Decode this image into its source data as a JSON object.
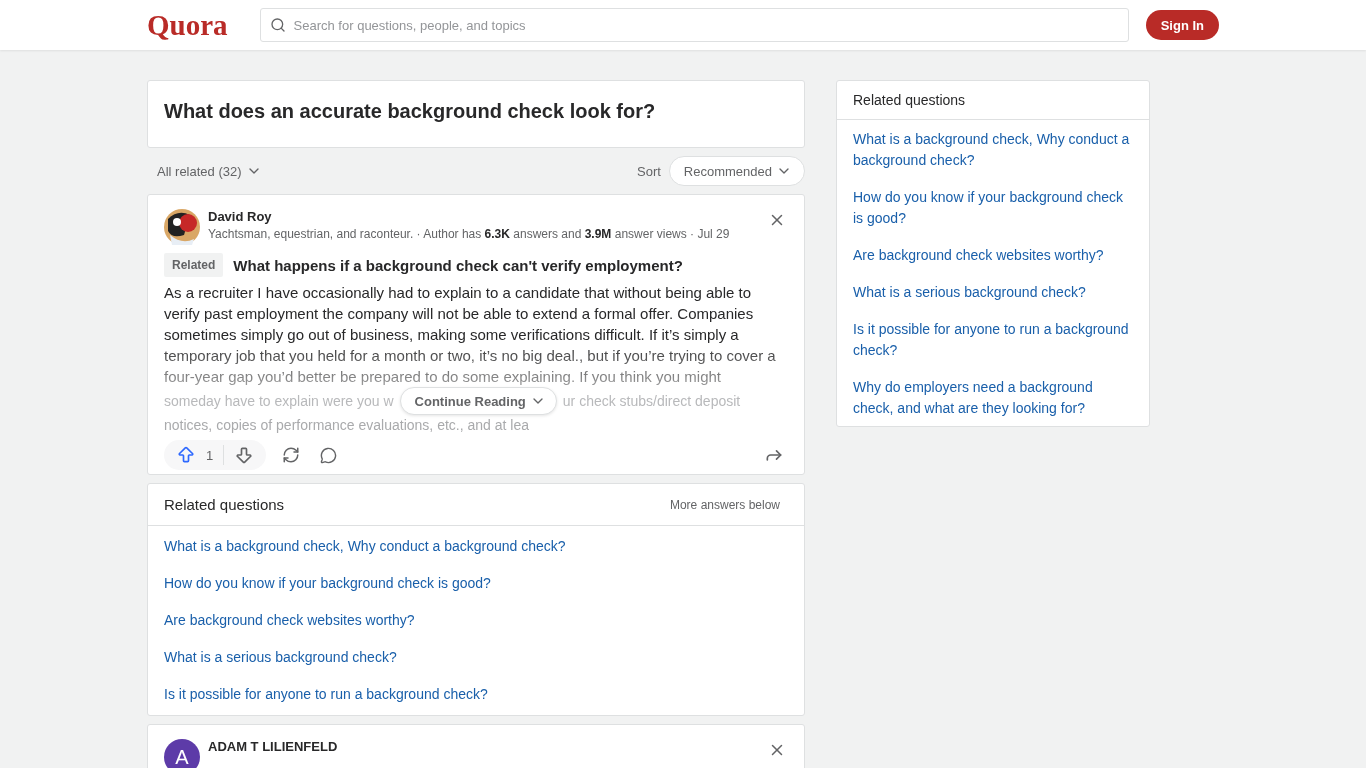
{
  "header": {
    "logo": "Quora",
    "search_placeholder": "Search for questions, people, and topics",
    "sign_in": "Sign In"
  },
  "question": {
    "title": "What does an accurate background check look for?"
  },
  "filter": {
    "all_related": "All related (32)",
    "sort_label": "Sort",
    "sort_value": "Recommended"
  },
  "answers": [
    {
      "author": "David Roy",
      "kind": "cartoon",
      "credential": "Yachtsman, equestrian, and raconteur. · Author has **6.3K** answers and **3.9M** answer views · Jul 29",
      "tag": "Related",
      "related_question": "What happens if a background check can't verify employment?",
      "body": "As a recruiter I have occasionally had to explain to a candidate that without being able to verify past employment the company will not be able to extend a formal offer. Companies sometimes simply go out of business, making some verifications difficult. If it’s simply a temporary job that you held for a month or two, it’s no big deal., but if you’re trying to cover a four-year gap you’d better be prepared to do some explaining. If you think you might",
      "body_before": "someday have to explain were you w",
      "body_after": "ur check stubs/direct deposit",
      "body_last": "notices, copies of performance evaluations, etc., and at lea",
      "continue": "Continue Reading",
      "upvotes": "1"
    },
    {
      "author": "ADAM T LILIENFELD",
      "kind": "letter",
      "initial": "A"
    }
  ],
  "related_inline": {
    "title": "Related questions",
    "more": "More answers below",
    "items": [
      "What is a background check, Why conduct a background check?",
      "How do you know if your background check is good?",
      "Are background check websites worthy?",
      "What is a serious background check?",
      "Is it possible for anyone to run a background check?"
    ]
  },
  "sidebar": {
    "title": "Related questions",
    "items": [
      "What is a background check, Why conduct a background check?",
      "How do you know if your background check is good?",
      "Are background check websites worthy?",
      "What is a serious background check?",
      "Is it possible for anyone to run a background check?",
      "Why do employers need a background check, and what are they looking for?"
    ]
  }
}
